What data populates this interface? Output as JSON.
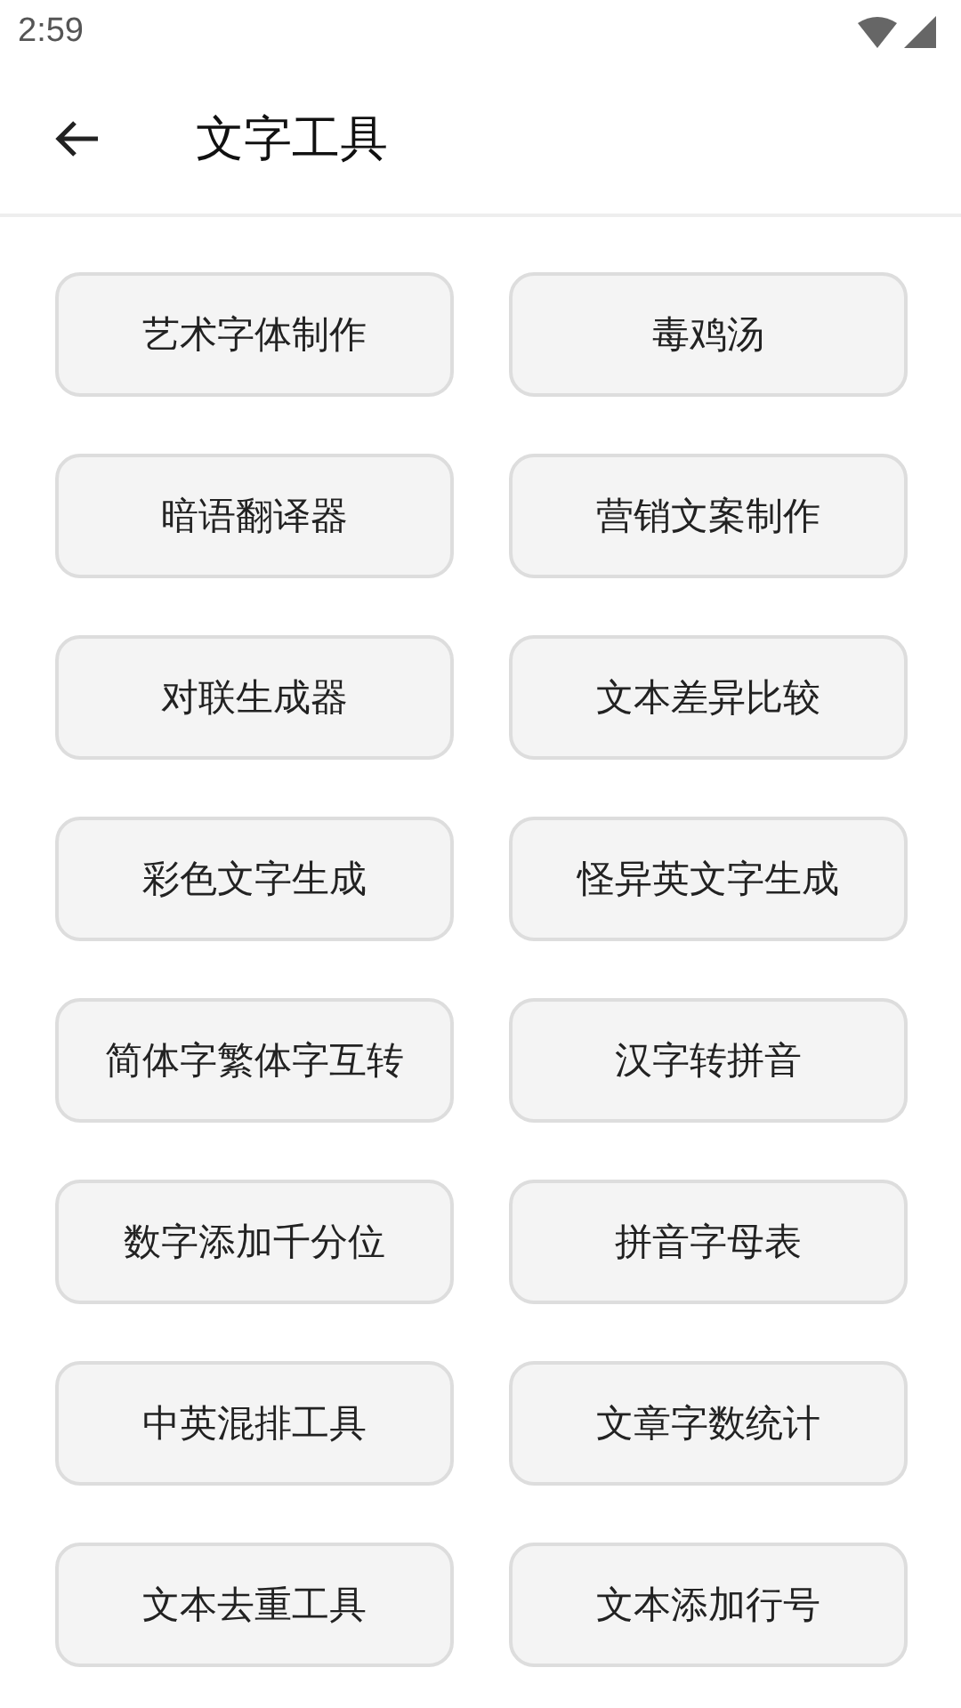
{
  "status_bar": {
    "time": "2:59"
  },
  "app_bar": {
    "title": "文字工具"
  },
  "tools": [
    "艺术字体制作",
    "毒鸡汤",
    "暗语翻译器",
    "营销文案制作",
    "对联生成器",
    "文本差异比较",
    "彩色文字生成",
    "怪异英文字生成",
    "简体字繁体字互转",
    "汉字转拼音",
    "数字添加千分位",
    "拼音字母表",
    "中英混排工具",
    "文章字数统计",
    "文本去重工具",
    "文本添加行号"
  ]
}
